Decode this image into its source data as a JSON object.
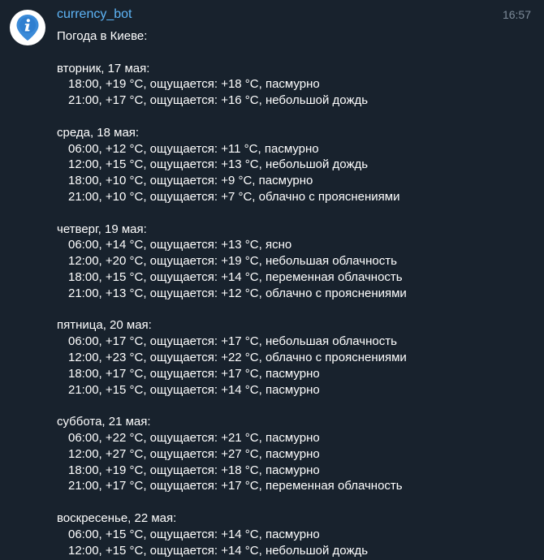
{
  "message": {
    "sender": "currency_bot",
    "time": "16:57",
    "avatar_icon": "info-location-pin-icon",
    "accent_color": "#5eb5f7",
    "greeting": "Погода в Киеве:",
    "days": [
      {
        "title": "вторник, 17 мая:",
        "entries": [
          "18:00, +19 °C, ощущается: +18 °C, пасмурно",
          "21:00, +17 °C, ощущается: +16 °C, небольшой дождь"
        ]
      },
      {
        "title": "среда, 18 мая:",
        "entries": [
          "06:00, +12 °C, ощущается: +11 °C, пасмурно",
          "12:00, +15 °C, ощущается: +13 °C, небольшой дождь",
          "18:00, +10 °C, ощущается: +9 °C, пасмурно",
          "21:00, +10 °C, ощущается: +7 °C, облачно с прояснениями"
        ]
      },
      {
        "title": "четверг, 19 мая:",
        "entries": [
          "06:00, +14 °C, ощущается: +13 °C, ясно",
          "12:00, +20 °C, ощущается: +19 °C, небольшая облачность",
          "18:00, +15 °C, ощущается: +14 °C, переменная облачность",
          "21:00, +13 °C, ощущается: +12 °C, облачно с прояснениями"
        ]
      },
      {
        "title": "пятница, 20 мая:",
        "entries": [
          "06:00, +17 °C, ощущается: +17 °C, небольшая облачность",
          "12:00, +23 °C, ощущается: +22 °C, облачно с прояснениями",
          "18:00, +17 °C, ощущается: +17 °C, пасмурно",
          "21:00, +15 °C, ощущается: +14 °C, пасмурно"
        ]
      },
      {
        "title": "суббота, 21 мая:",
        "entries": [
          "06:00, +22 °C, ощущается: +21 °C, пасмурно",
          "12:00, +27 °C, ощущается: +27 °C, пасмурно",
          "18:00, +19 °C, ощущается: +18 °C, пасмурно",
          "21:00, +17 °C, ощущается: +17 °C, переменная облачность"
        ]
      },
      {
        "title": "воскресенье, 22 мая:",
        "entries": [
          "06:00, +15 °C, ощущается: +14 °C, пасмурно",
          "12:00, +15 °C, ощущается: +14 °C, небольшой дождь"
        ]
      }
    ]
  }
}
